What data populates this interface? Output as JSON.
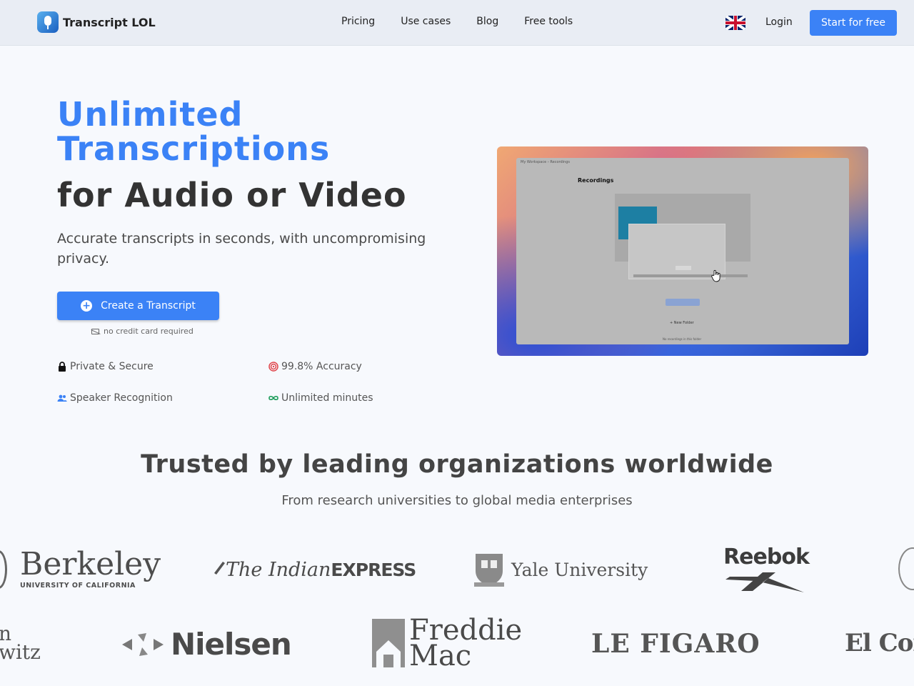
{
  "header": {
    "brand": "Transcript LOL",
    "nav": [
      "Pricing",
      "Use cases",
      "Blog",
      "Free tools"
    ],
    "login": "Login",
    "start": "Start for free"
  },
  "hero": {
    "title_line1": "Unlimited",
    "title_line2": "Transcriptions",
    "title_line3": "for Audio or Video",
    "subtitle": "Accurate transcripts in seconds, with uncompromising privacy.",
    "cta": "Create a Transcript",
    "no_card": "no credit card required",
    "features": [
      "Private & Secure",
      "99.8% Accuracy",
      "Speaker Recognition",
      "Unlimited minutes"
    ]
  },
  "preview": {
    "crumb": "My Workspace  ›  Recordings",
    "title": "Recordings",
    "new_folder": "+ New Folder",
    "footer": "No recordings in this folder"
  },
  "trusted": {
    "title": "Trusted by leading organizations worldwide",
    "subtitle": "From research universities to global media enterprises",
    "row1": {
      "berkeley_main": "Berkeley",
      "berkeley_sub": "UNIVERSITY OF CALIFORNIA",
      "indian_express_a": "The Indian",
      "indian_express_b": "EXPRESS",
      "yale": "Yale University",
      "reebok": "Reebok"
    },
    "row2": {
      "partial_left_a": "n",
      "partial_left_b": "witz",
      "nielsen": "Nielsen",
      "freddie_a": "Freddie",
      "freddie_b": "Mac",
      "figaro": "LE FIGARO",
      "el_con": "El Con"
    }
  }
}
